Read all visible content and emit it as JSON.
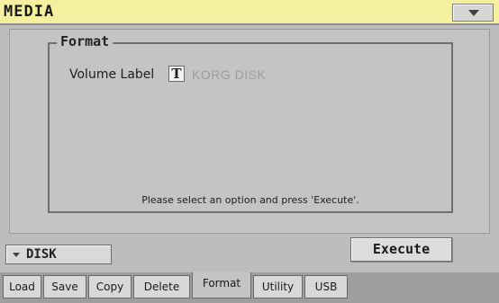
{
  "header": {
    "title": "MEDIA",
    "menu_icon": "triangle-down"
  },
  "format_group": {
    "title": "Format",
    "volume_label": "Volume Label",
    "text_edit_icon": "T",
    "volume_value": "KORG DISK",
    "message": "Please select an option and press 'Execute'."
  },
  "device_select": {
    "label": "DISK",
    "icon": "triangle-down"
  },
  "execute_label": "Execute",
  "tabs": [
    {
      "label": "Load"
    },
    {
      "label": "Save"
    },
    {
      "label": "Copy"
    },
    {
      "label": "Delete"
    },
    {
      "label": "Format",
      "active": true
    },
    {
      "label": "Utility"
    },
    {
      "label": "USB"
    }
  ]
}
